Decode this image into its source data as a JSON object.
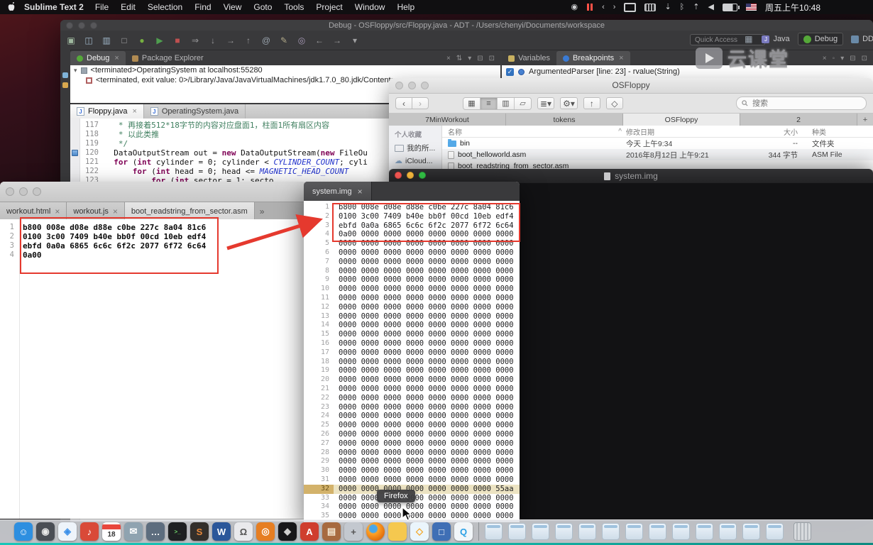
{
  "menu_bar": {
    "app_name": "Sublime Text 2",
    "menus": [
      "File",
      "Edit",
      "Selection",
      "Find",
      "View",
      "Goto",
      "Tools",
      "Project",
      "Window",
      "Help"
    ],
    "status_icons": [
      "screen-record",
      "pause",
      "back",
      "forward",
      "display",
      "keyboard",
      "download",
      "bluetooth",
      "up",
      "volume",
      "battery",
      "flag"
    ],
    "clock": "周五上午10:48"
  },
  "eclipse": {
    "title": "Debug - OSFloppy/src/Floppy.java - ADT - /Users/chenyi/Documents/workspace",
    "quick_access": "Quick Access",
    "toolbar_icons": [
      {
        "name": "new-wizard",
        "glyph": "▣",
        "color": "#9fb89f"
      },
      {
        "name": "save",
        "glyph": "◫",
        "color": "#9fb6c9"
      },
      {
        "name": "save-all",
        "glyph": "▥",
        "color": "#9fb6c9"
      },
      {
        "name": "print",
        "glyph": "□",
        "color": "#a8a8aa"
      },
      {
        "name": "debug",
        "glyph": "●",
        "color": "#76b041"
      },
      {
        "name": "run",
        "glyph": "▶",
        "color": "#4f9e4f"
      },
      {
        "name": "stop",
        "glyph": "■",
        "color": "#c05050"
      },
      {
        "name": "resume",
        "glyph": "⇒",
        "color": "#9a9a9c"
      },
      {
        "name": "step-into",
        "glyph": "↓",
        "color": "#9a9a9c"
      },
      {
        "name": "step-over",
        "glyph": "→",
        "color": "#9a9a9c"
      },
      {
        "name": "step-return",
        "glyph": "↑",
        "color": "#9a9a9c"
      },
      {
        "name": "javadoc",
        "glyph": "@",
        "color": "#9aa4ae"
      },
      {
        "name": "new-task",
        "glyph": "✎",
        "color": "#b0a888"
      },
      {
        "name": "search",
        "glyph": "◎",
        "color": "#a89ab8"
      },
      {
        "name": "back-history",
        "glyph": "←",
        "color": "#a0a0a2"
      },
      {
        "name": "forward-history",
        "glyph": "→",
        "color": "#a0a0a2"
      },
      {
        "name": "menu-dropdown",
        "glyph": "▾",
        "color": "#a0a0a2"
      }
    ],
    "perspectives": [
      {
        "label": "Java"
      },
      {
        "label": "Debug",
        "active": true
      },
      {
        "label": "DD"
      }
    ],
    "debug_view": {
      "tab_debug": "Debug",
      "tab_package_explorer": "Package Explorer",
      "toolbar_icons": [
        "terminate",
        "disconnect",
        "view-menu",
        "minimize",
        "maximize"
      ],
      "console_lines": [
        "<terminated>OperatingSystem at localhost:55280",
        "<terminated, exit value: 0>/Library/Java/JavaVirtualMachines/jdk1.7.0_80.jdk/Contents..."
      ]
    },
    "right_view": {
      "tab_variables": "Variables",
      "tab_breakpoints": "Breakpoints",
      "toolbar_icons": [
        "remove",
        "remove-all",
        "view-menu",
        "minimize",
        "maximize"
      ],
      "breakpoint_item": "ArgumentedParser [line: 23] - rvalue(String)"
    },
    "editor": {
      "tabs": [
        "Floppy.java",
        "OperatingSystem.java"
      ],
      "code_lines": [
        {
          "num": "117",
          "segments": [
            {
              "text": "   * 再接着512*18字节的内容对应盘面1，柱面1所有扇区内容",
              "cls": "comment"
            }
          ]
        },
        {
          "num": "118",
          "segments": [
            {
              "text": "   * 以此类推",
              "cls": "comment"
            }
          ]
        },
        {
          "num": "119",
          "segments": [
            {
              "text": "   */",
              "cls": "comment"
            }
          ]
        },
        {
          "num": "120",
          "marker": true,
          "segments": [
            {
              "text": "  DataOutputStream out = ",
              "cls": "plain"
            },
            {
              "text": "new",
              "cls": "keyword"
            },
            {
              "text": " DataOutputStream(",
              "cls": "plain"
            },
            {
              "text": "new",
              "cls": "keyword"
            },
            {
              "text": " FileOu",
              "cls": "plain"
            }
          ]
        },
        {
          "num": "121",
          "segments": [
            {
              "text": "  ",
              "cls": "plain"
            },
            {
              "text": "for",
              "cls": "keyword"
            },
            {
              "text": " (",
              "cls": "plain"
            },
            {
              "text": "int",
              "cls": "keyword"
            },
            {
              "text": " cylinder = 0; cylinder < ",
              "cls": "plain"
            },
            {
              "text": "CYLINDER_COUNT",
              "cls": "constant"
            },
            {
              "text": "; cyli",
              "cls": "plain"
            }
          ]
        },
        {
          "num": "122",
          "segments": [
            {
              "text": "      ",
              "cls": "plain"
            },
            {
              "text": "for",
              "cls": "keyword"
            },
            {
              "text": " (",
              "cls": "plain"
            },
            {
              "text": "int",
              "cls": "keyword"
            },
            {
              "text": " head = 0; head <= ",
              "cls": "plain"
            },
            {
              "text": "MAGNETIC_HEAD_COUNT",
              "cls": "constant"
            }
          ]
        },
        {
          "num": "123",
          "segments": [
            {
              "text": "          ",
              "cls": "plain"
            },
            {
              "text": "for",
              "cls": "keyword"
            },
            {
              "text": " (",
              "cls": "plain"
            },
            {
              "text": "int",
              "cls": "keyword"
            },
            {
              "text": " sector = 1; secto",
              "cls": "plain"
            }
          ]
        }
      ]
    }
  },
  "finder": {
    "title": "OSFloppy",
    "search_placeholder": "搜索",
    "toolbar": {
      "views": [
        "icon-view",
        "list-view",
        "column-view",
        "flow-view"
      ],
      "selected_view": "list-view",
      "buttons": [
        "arrange",
        "action",
        "share",
        "tag"
      ]
    },
    "window_tabs": [
      {
        "label": "7MinWorkout"
      },
      {
        "label": "tokens"
      },
      {
        "label": "OSFloppy",
        "active": true
      },
      {
        "label": "2"
      }
    ],
    "new_tab": "+",
    "sidebar": {
      "section": "个人收藏",
      "items": [
        {
          "label": "我的所...",
          "icon": "display"
        },
        {
          "label": "iCloud...",
          "icon": "cloud"
        }
      ]
    },
    "columns": {
      "name": "名称",
      "date": "修改日期",
      "size": "大小",
      "kind": "种类"
    },
    "rows": [
      {
        "name": "bin",
        "date": "今天 上午9:34",
        "size": "--",
        "kind": "文件夹",
        "icon": "folder"
      },
      {
        "name": "boot_helloworld.asm",
        "date": "2016年8月12日 上午9:21",
        "size": "344 字节",
        "kind": "ASM File",
        "icon": "file"
      },
      {
        "name": "boot_readstring_from_sector.asm",
        "date": "",
        "size": "",
        "kind": "",
        "icon": "file"
      }
    ]
  },
  "dark_window": {
    "title": "system.img"
  },
  "sublime_left": {
    "tabs": [
      {
        "label": "workout.html",
        "close": true
      },
      {
        "label": "workout.js",
        "close": true
      },
      {
        "label": "boot_readstring_from_sector.asm",
        "active": true
      }
    ],
    "overflow": "»",
    "hex_lines": [
      "b800 008e d08e d88e c0be 227c 8a04 81c6",
      "0100 3c00 7409 b40e bb0f 00cd 10eb edf4",
      "ebfd 0a0a 6865 6c6c 6f2c 2077 6f72 6c64",
      "0a00"
    ]
  },
  "hex_viewer": {
    "tab": "system.img",
    "highlighted_line": 32,
    "hex_lines": [
      "b800 008e d08e d88e c0be 227c 8a04 81c6",
      "0100 3c00 7409 b40e bb0f 00cd 10eb edf4",
      "ebfd 0a0a 6865 6c6c 6f2c 2077 6f72 6c64",
      "0a00 0000 0000 0000 0000 0000 0000 0000",
      "0000 0000 0000 0000 0000 0000 0000 0000",
      "0000 0000 0000 0000 0000 0000 0000 0000",
      "0000 0000 0000 0000 0000 0000 0000 0000",
      "0000 0000 0000 0000 0000 0000 0000 0000",
      "0000 0000 0000 0000 0000 0000 0000 0000",
      "0000 0000 0000 0000 0000 0000 0000 0000",
      "0000 0000 0000 0000 0000 0000 0000 0000",
      "0000 0000 0000 0000 0000 0000 0000 0000",
      "0000 0000 0000 0000 0000 0000 0000 0000",
      "0000 0000 0000 0000 0000 0000 0000 0000",
      "0000 0000 0000 0000 0000 0000 0000 0000",
      "0000 0000 0000 0000 0000 0000 0000 0000",
      "0000 0000 0000 0000 0000 0000 0000 0000",
      "0000 0000 0000 0000 0000 0000 0000 0000",
      "0000 0000 0000 0000 0000 0000 0000 0000",
      "0000 0000 0000 0000 0000 0000 0000 0000",
      "0000 0000 0000 0000 0000 0000 0000 0000",
      "0000 0000 0000 0000 0000 0000 0000 0000",
      "0000 0000 0000 0000 0000 0000 0000 0000",
      "0000 0000 0000 0000 0000 0000 0000 0000",
      "0000 0000 0000 0000 0000 0000 0000 0000",
      "0000 0000 0000 0000 0000 0000 0000 0000",
      "0000 0000 0000 0000 0000 0000 0000 0000",
      "0000 0000 0000 0000 0000 0000 0000 0000",
      "0000 0000 0000 0000 0000 0000 0000 0000",
      "0000 0000 0000 0000 0000 0000 0000 0000",
      "0000 0000 0000 0000 0000 0000 0000 0000",
      "0000 0000 0000 0000 0000 0000 0000 55aa",
      "0000 0000 0000 0000 0000 0000 0000 0000",
      "0000 0000 0000 0000 0000 0000 0000 0000",
      "0000 0000 0000 0000 0000 0000 0000 0000"
    ]
  },
  "dock": {
    "tooltip": "Firefox",
    "apps": [
      {
        "name": "finder",
        "color": "#2e8fe0"
      },
      {
        "name": "photos",
        "color": "#4a4e55"
      },
      {
        "name": "safari",
        "color": "#eef4fa"
      },
      {
        "name": "music",
        "color": "#d94a38"
      },
      {
        "name": "calendar",
        "color": "#ffffff",
        "day": "18"
      },
      {
        "name": "mail",
        "color": "#8fa3b0"
      },
      {
        "name": "messages",
        "color": "#5d6d7e"
      },
      {
        "name": "terminal",
        "color": "#1e2022"
      },
      {
        "name": "sublime-text",
        "color": "#332f2b"
      },
      {
        "name": "word",
        "color": "#2b579a"
      },
      {
        "name": "omnigraffle",
        "color": "#e9e9ec"
      },
      {
        "name": "orange-app",
        "color": "#e67e22"
      },
      {
        "name": "dark-app",
        "color": "#17171a"
      },
      {
        "name": "adobe",
        "color": "#cf3e2e"
      },
      {
        "name": "books",
        "color": "#a76a3f"
      },
      {
        "name": "launchpad",
        "color": "#c3c8cf"
      },
      {
        "name": "firefox",
        "color": ""
      },
      {
        "name": "downloads-folder",
        "color": "#f5c84f"
      },
      {
        "name": "sketch",
        "color": "#eaf5fc"
      },
      {
        "name": "box-app",
        "color": "#3f6fb5"
      },
      {
        "name": "qq",
        "color": "#f2f6f9"
      }
    ],
    "window_icons_count": 13
  },
  "watermark": "云课堂"
}
